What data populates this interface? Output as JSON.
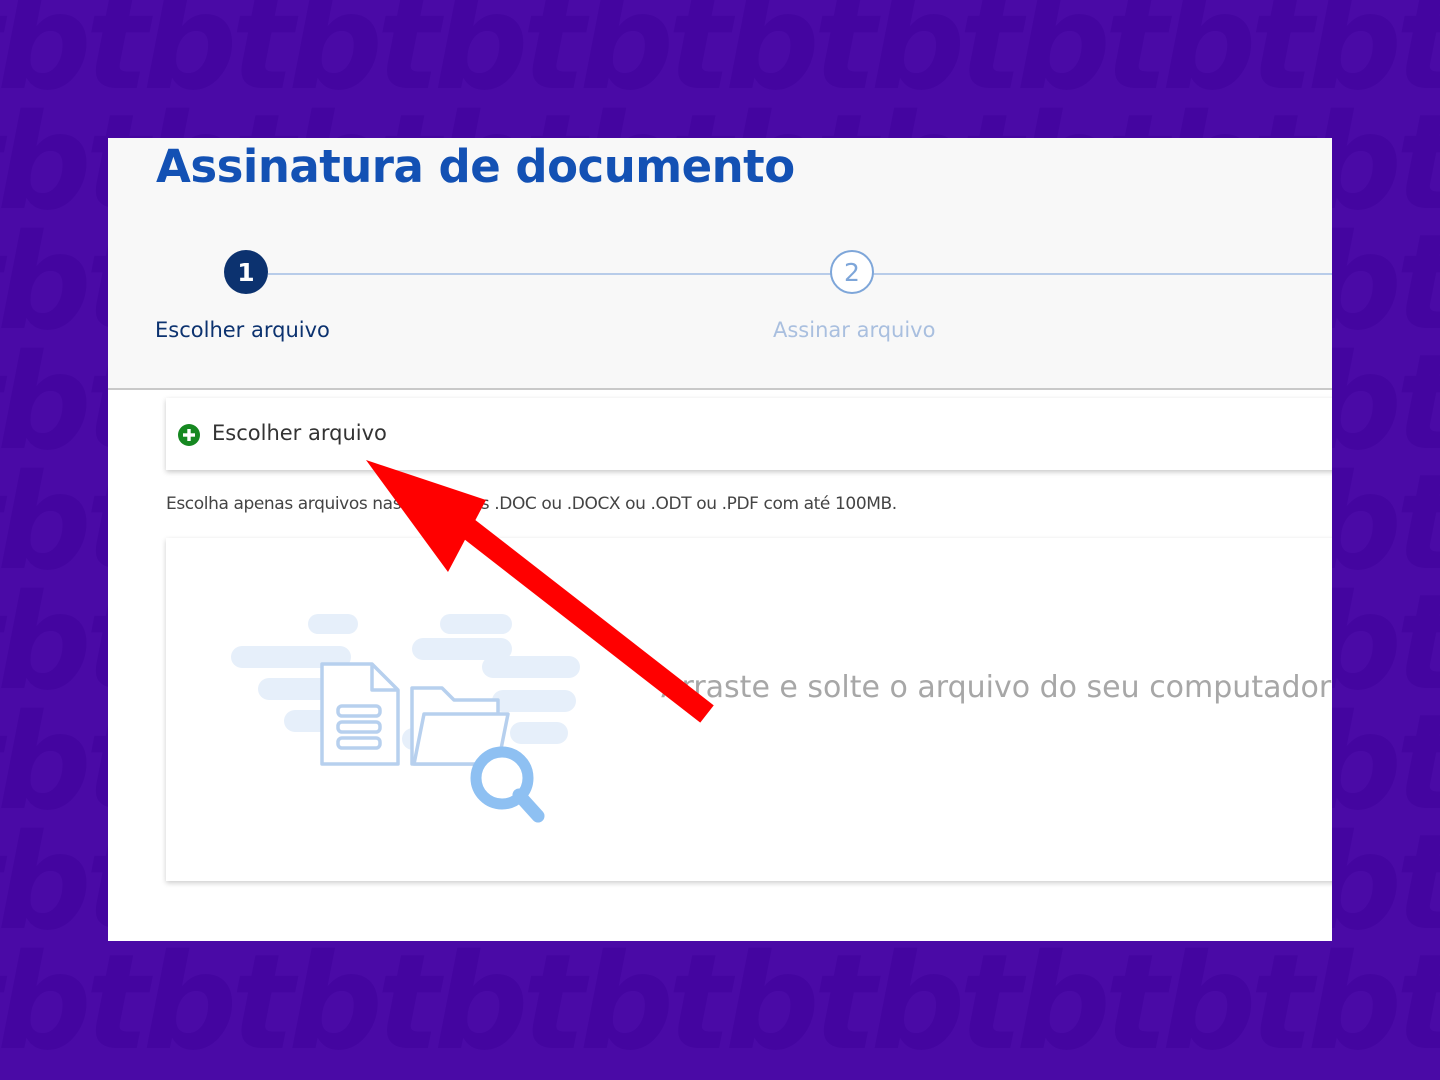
{
  "page": {
    "title": "Assinatura de documento"
  },
  "stepper": {
    "steps": [
      {
        "number": "1",
        "label": "Escolher arquivo",
        "state": "active"
      },
      {
        "number": "2",
        "label": "Assinar arquivo",
        "state": "inactive"
      }
    ]
  },
  "upload": {
    "choose_label": "Escolher arquivo",
    "choose_icon": "plus-circle-icon",
    "hint": "Escolha apenas arquivos nas extensões .DOC ou .DOCX ou .ODT ou .PDF com até 100MB.",
    "drop_text": "Arraste e solte o arquivo do seu computador",
    "illustration_icons": [
      "document-icon",
      "folder-icon",
      "magnifier-icon"
    ]
  },
  "annotation": {
    "arrow_icon": "red-arrow-icon",
    "arrow_color": "#ff0000"
  },
  "colors": {
    "background": "#4a0aa6",
    "title": "#1351b4",
    "step_active": "#0c326f",
    "step_inactive": "#7ea6d9",
    "plus_icon": "#168821"
  }
}
